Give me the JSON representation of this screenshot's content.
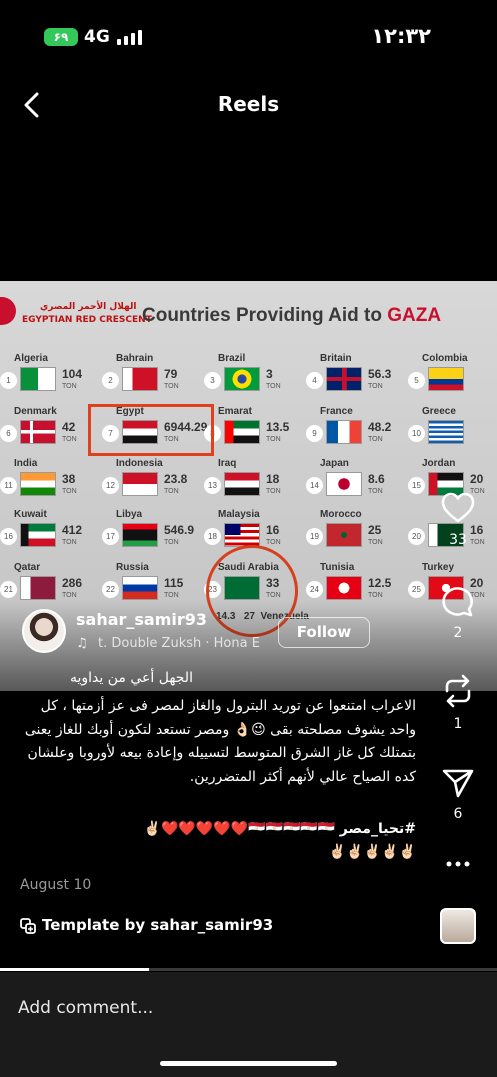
{
  "status_bar": {
    "battery": "۶۹",
    "network": "4G",
    "time": "١٢:٣٢"
  },
  "header": {
    "title": "Reels"
  },
  "video": {
    "org_arabic": "الهلال الأحمر المصري",
    "org_english": "EGYPTIAN RED CRESCENT",
    "title_prefix": "Countries Providing Aid to ",
    "title_highlight": "GAZA",
    "unit": "TON",
    "countries": [
      {
        "n": "1",
        "name": "Algeria",
        "qty": "104"
      },
      {
        "n": "2",
        "name": "Bahrain",
        "qty": "79"
      },
      {
        "n": "3",
        "name": "Brazil",
        "qty": "3"
      },
      {
        "n": "4",
        "name": "Britain",
        "qty": "56.3"
      },
      {
        "n": "5",
        "name": "Colombia",
        "qty": ""
      },
      {
        "n": "6",
        "name": "Denmark",
        "qty": "42"
      },
      {
        "n": "7",
        "name": "Egypt",
        "qty": "6944.29"
      },
      {
        "n": "8",
        "name": "Emarat",
        "qty": "13.5"
      },
      {
        "n": "9",
        "name": "France",
        "qty": "48.2"
      },
      {
        "n": "10",
        "name": "Greece",
        "qty": ""
      },
      {
        "n": "11",
        "name": "India",
        "qty": "38"
      },
      {
        "n": "12",
        "name": "Indonesia",
        "qty": "23.8"
      },
      {
        "n": "13",
        "name": "Iraq",
        "qty": "18"
      },
      {
        "n": "14",
        "name": "Japan",
        "qty": "8.6"
      },
      {
        "n": "15",
        "name": "Jordan",
        "qty": "20"
      },
      {
        "n": "16",
        "name": "Kuwait",
        "qty": "412"
      },
      {
        "n": "17",
        "name": "Libya",
        "qty": "546.9"
      },
      {
        "n": "18",
        "name": "Malaysia",
        "qty": "16"
      },
      {
        "n": "19",
        "name": "Morocco",
        "qty": "25"
      },
      {
        "n": "20",
        "name": "",
        "qty": "16"
      },
      {
        "n": "21",
        "name": "Qatar",
        "qty": "286"
      },
      {
        "n": "22",
        "name": "Russia",
        "qty": "115"
      },
      {
        "n": "23",
        "name": "Saudi Arabia",
        "qty": "33"
      },
      {
        "n": "24",
        "name": "Tunisia",
        "qty": "12.5"
      },
      {
        "n": "25",
        "name": "Turkey",
        "qty": "20"
      }
    ],
    "partial_row": {
      "venezuela": "Venezuela",
      "qty": "14.3",
      "n": "27"
    }
  },
  "user": {
    "username": "sahar_samir93",
    "audio": "t. Double Zuksh · Hona E",
    "follow_label": "Follow",
    "subtitle": "الجهل أعي من يداويه"
  },
  "caption": {
    "text": "الاعراب امتنعوا عن توريد البترول والغاز لمصر فى عز أزمتها ، كل واحد يشوف مصلحته بقى 😉👌🏻 ومصر تستعد لتكون أوبك للغاز يعنى بتمتلك كل غاز الشرق المتوسط لتسييله وإعادة بيعه لأوروبا وعلشان كده الصياح عالي لأنهم أكثر المتضررين.",
    "hashtag": "#تحيا_مصر",
    "emojis_line1": "🇪🇬🇪🇬🇪🇬🇪🇬🇪🇬❤️❤️❤️❤️❤️✌🏻",
    "emojis_line2": "✌🏻✌🏻✌🏻✌🏻✌🏻"
  },
  "date": "August 10",
  "template": {
    "label": "Template by sahar_samir93"
  },
  "actions": {
    "likes": "33",
    "comments": "2",
    "reposts": "1",
    "shares": "6"
  },
  "playback": {
    "progress": 0.3
  },
  "comment_box": {
    "placeholder": "Add comment..."
  },
  "colors": {
    "accent_red": "#c8102e",
    "battery_green": "#34c759",
    "egypt_highlight": "#e0401c"
  }
}
